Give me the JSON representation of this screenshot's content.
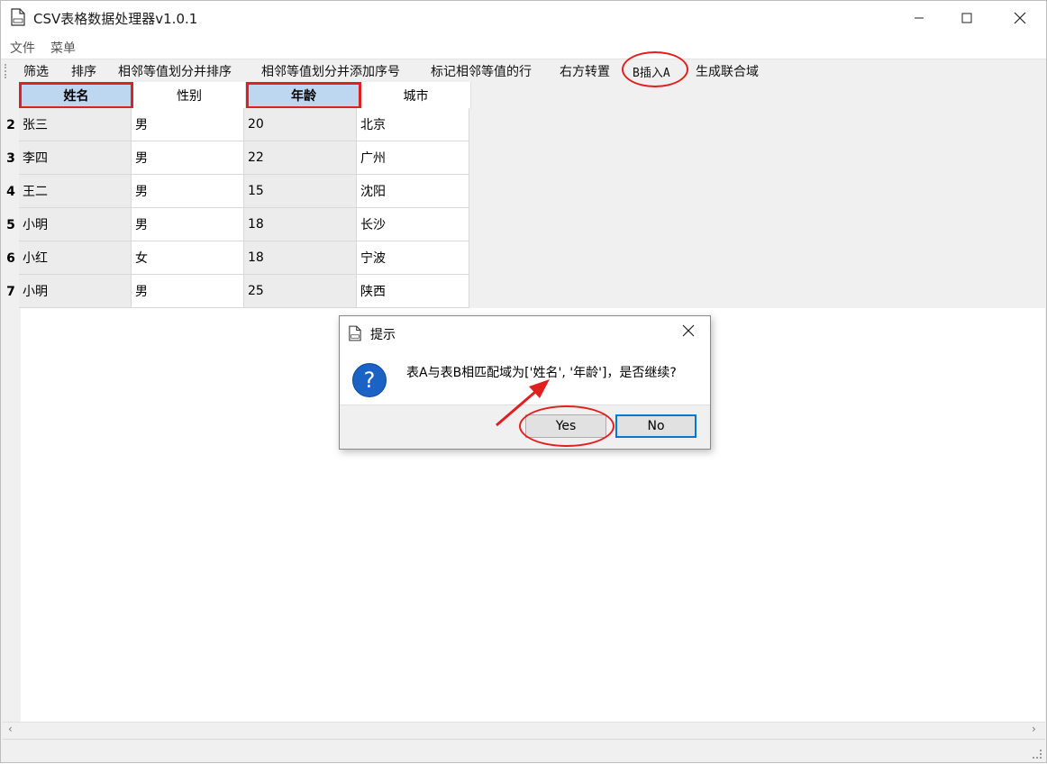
{
  "window": {
    "title": "CSV表格数据处理器v1.0.1",
    "minimize_icon": "minimize-icon",
    "maximize_icon": "maximize-icon",
    "close_icon": "close-icon"
  },
  "menubar": {
    "items": [
      "文件",
      "菜单"
    ]
  },
  "toolbar": {
    "items": [
      "筛选",
      "排序",
      "相邻等值划分并排序",
      "相邻等值划分并添加序号",
      "标记相邻等值的行",
      "右方转置",
      "B插入A",
      "生成联合域"
    ]
  },
  "table": {
    "columns": [
      "姓名",
      "性别",
      "年龄",
      "城市"
    ],
    "selected_columns": [
      "姓名",
      "年龄"
    ],
    "rows": [
      {
        "num": "2",
        "cells": [
          "张三",
          "男",
          "20",
          "北京"
        ]
      },
      {
        "num": "3",
        "cells": [
          "李四",
          "男",
          "22",
          "广州"
        ]
      },
      {
        "num": "4",
        "cells": [
          "王二",
          "男",
          "15",
          "沈阳"
        ]
      },
      {
        "num": "5",
        "cells": [
          "小明",
          "男",
          "18",
          "长沙"
        ]
      },
      {
        "num": "6",
        "cells": [
          "小红",
          "女",
          "18",
          "宁波"
        ]
      },
      {
        "num": "7",
        "cells": [
          "小明",
          "男",
          "25",
          "陕西"
        ]
      }
    ]
  },
  "dialog": {
    "title": "提示",
    "icon": "question-icon",
    "message": "表A与表B相匹配域为['姓名', '年龄']，是否继续?",
    "yes_label": "Yes",
    "no_label": "No"
  },
  "colors": {
    "annotation": "#e02020",
    "selected_header": "#bcd7ef",
    "default_button_border": "#0078d7"
  }
}
